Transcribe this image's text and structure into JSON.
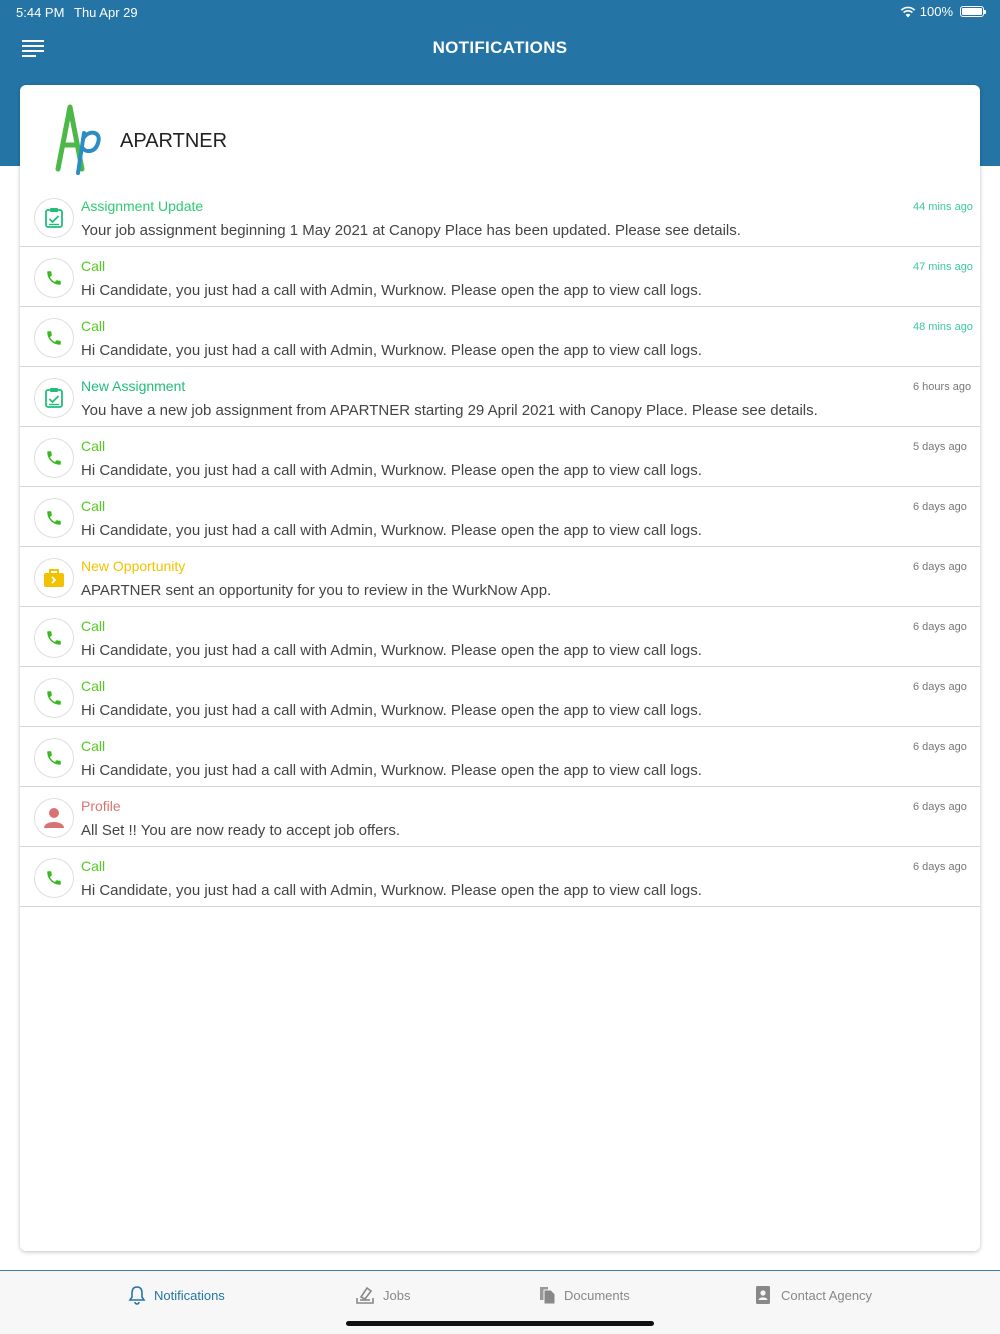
{
  "status_bar": {
    "time": "5:44 PM",
    "date": "Thu Apr 29",
    "battery": "100%"
  },
  "nav": {
    "title": "NOTIFICATIONS",
    "menu_icon": "menu-icon"
  },
  "agency": {
    "name": "APARTNER",
    "logo_text": "Ap"
  },
  "colors": {
    "header": "#2475a6",
    "green_title": "#2ecc71",
    "call_title": "#55cc22",
    "assignment_title": "#1fbf7a",
    "opportunity_title": "#f2c200",
    "profile_title": "#d97373",
    "recent_time": "#3cc9a0"
  },
  "notifications": [
    {
      "icon": "clipboard-check-icon",
      "title": "Assignment Update",
      "message": "Your job assignment beginning 1 May 2021 at Canopy Place has been updated. Please see details.",
      "time": "44 mins ago"
    },
    {
      "icon": "phone-icon",
      "title": "Call",
      "message": "Hi Candidate, you just had a call with Admin, Wurknow. Please open the app to view call logs.",
      "time": "47 mins ago"
    },
    {
      "icon": "phone-icon",
      "title": "Call",
      "message": "Hi Candidate, you just had a call with Admin, Wurknow. Please open the app to view call logs.",
      "time": "48 mins ago"
    },
    {
      "icon": "clipboard-check-icon",
      "title": "New Assignment",
      "message": "You have a new job assignment from APARTNER starting 29 April 2021 with Canopy Place. Please see details.",
      "time": "6 hours ago"
    },
    {
      "icon": "phone-icon",
      "title": "Call",
      "message": "Hi Candidate, you just had a call with Admin, Wurknow. Please open the app to view call logs.",
      "time": "5 days ago"
    },
    {
      "icon": "phone-icon",
      "title": "Call",
      "message": "Hi Candidate, you just had a call with Admin, Wurknow. Please open the app to view call logs.",
      "time": "6 days ago"
    },
    {
      "icon": "briefcase-icon",
      "title": "New Opportunity",
      "message": "APARTNER sent an opportunity for you to review in the WurkNow App.",
      "time": "6 days ago"
    },
    {
      "icon": "phone-icon",
      "title": "Call",
      "message": "Hi Candidate, you just had a call with Admin, Wurknow. Please open the app to view call logs.",
      "time": "6 days ago"
    },
    {
      "icon": "phone-icon",
      "title": "Call",
      "message": "Hi Candidate, you just had a call with Admin, Wurknow. Please open the app to view call logs.",
      "time": "6 days ago"
    },
    {
      "icon": "phone-icon",
      "title": "Call",
      "message": "Hi Candidate, you just had a call with Admin, Wurknow. Please open the app to view call logs.",
      "time": "6 days ago"
    },
    {
      "icon": "person-icon",
      "title": "Profile",
      "message": "All Set !! You are now ready to accept job offers.",
      "time": "6 days ago"
    },
    {
      "icon": "phone-icon",
      "title": "Call",
      "message": "Hi Candidate, you just had a call with Admin, Wurknow. Please open the app to view call logs.",
      "time": "6 days ago"
    }
  ],
  "tabs": [
    {
      "label": "Notifications",
      "icon": "bell-icon",
      "active": true
    },
    {
      "label": "Jobs",
      "icon": "jobs-icon",
      "active": false
    },
    {
      "label": "Documents",
      "icon": "documents-icon",
      "active": false
    },
    {
      "label": "Contact Agency",
      "icon": "contact-icon",
      "active": false
    }
  ]
}
